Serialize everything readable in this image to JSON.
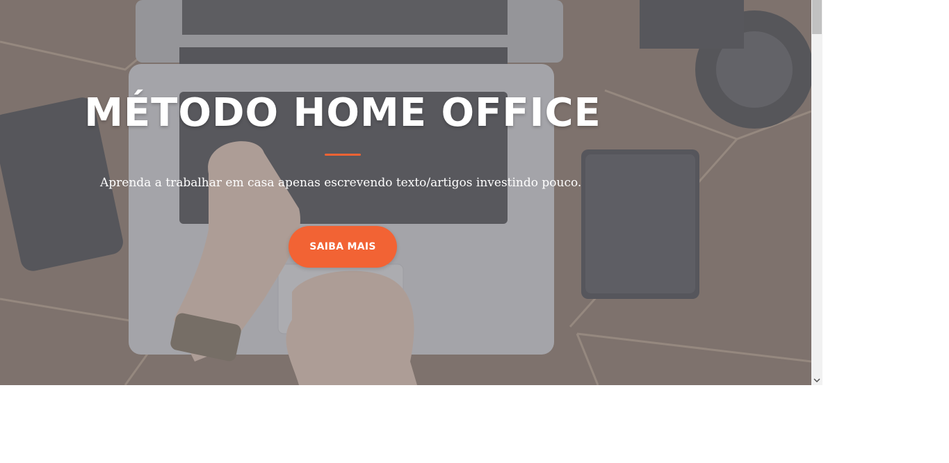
{
  "hero": {
    "title": "MÉTODO HOME OFFICE",
    "subtitle": "Aprenda a trabalhar em casa apenas escrevendo texto/artigos investindo pouco.",
    "cta_label": "SAIBA MAIS",
    "background_image": "laptop-desk-photo"
  },
  "colors": {
    "accent": "#f26334",
    "overlay": "#828288",
    "text": "#ffffff"
  },
  "scrollbar": {
    "down_arrow_icon": "chevron-down-icon"
  }
}
